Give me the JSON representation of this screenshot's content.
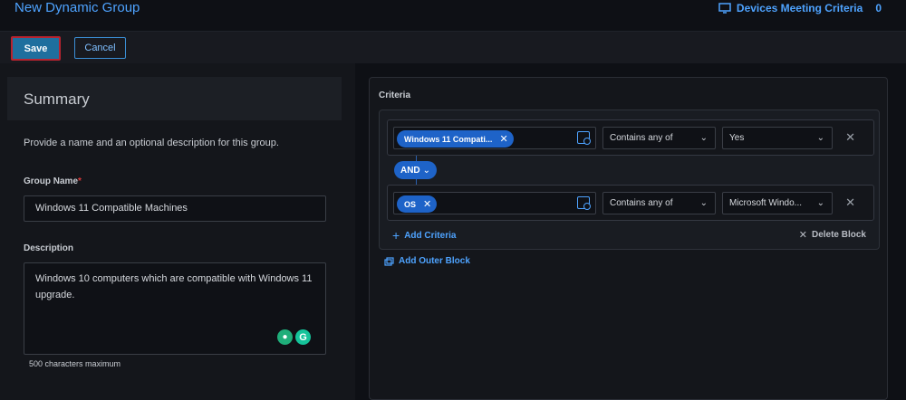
{
  "header": {
    "title": "New Dynamic Group",
    "devices_label": "Devices Meeting Criteria",
    "devices_count": "0"
  },
  "toolbar": {
    "save_label": "Save",
    "cancel_label": "Cancel"
  },
  "summary": {
    "heading": "Summary",
    "intro": "Provide a name and an optional description for this group.",
    "group_name_label": "Group Name",
    "required_mark": "*",
    "group_name_value": "Windows 11 Compatible Machines",
    "description_label": "Description",
    "description_value": "Windows 10 computers which are compatible with Windows 11 upgrade.",
    "char_limit": "500 characters maximum",
    "assist_icon_1": "lightbulb-icon",
    "assist_icon_2": "grammarly-icon"
  },
  "criteria": {
    "label": "Criteria",
    "rows": [
      {
        "field_chip": "Windows 11 Compati...",
        "operator": "Contains any of",
        "value": "Yes"
      },
      {
        "field_chip": "OS",
        "operator": "Contains any of",
        "value": "Microsoft Windo..."
      }
    ],
    "join_label": "AND",
    "add_criteria_label": "Add Criteria",
    "delete_block_label": "Delete Block",
    "add_outer_block_label": "Add Outer Block"
  },
  "colors": {
    "accent": "#4ea3ff",
    "chip": "#1e63c8",
    "save_bg": "#1f6f9e",
    "save_border": "#b8232f",
    "required": "#e03a3a"
  }
}
